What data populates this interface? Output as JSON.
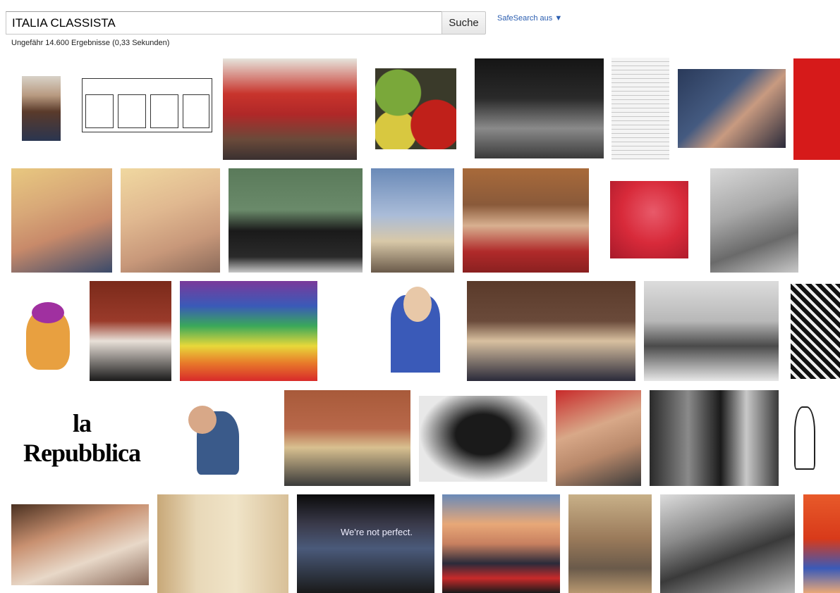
{
  "search": {
    "query": "ITALIA CLASSISTA",
    "button_label": "Suche"
  },
  "safesearch": {
    "label": "SafeSearch aus ▼"
  },
  "results": {
    "summary": "Ungefähr 14.600 Ergebnisse (0,33 Sekunden)"
  },
  "thumbs": {
    "la_repubblica": "la Repubblica",
    "apple_slide": "We're not perfect."
  },
  "colors": {
    "link": "#2a5db0",
    "border": "#c6c6c6"
  }
}
